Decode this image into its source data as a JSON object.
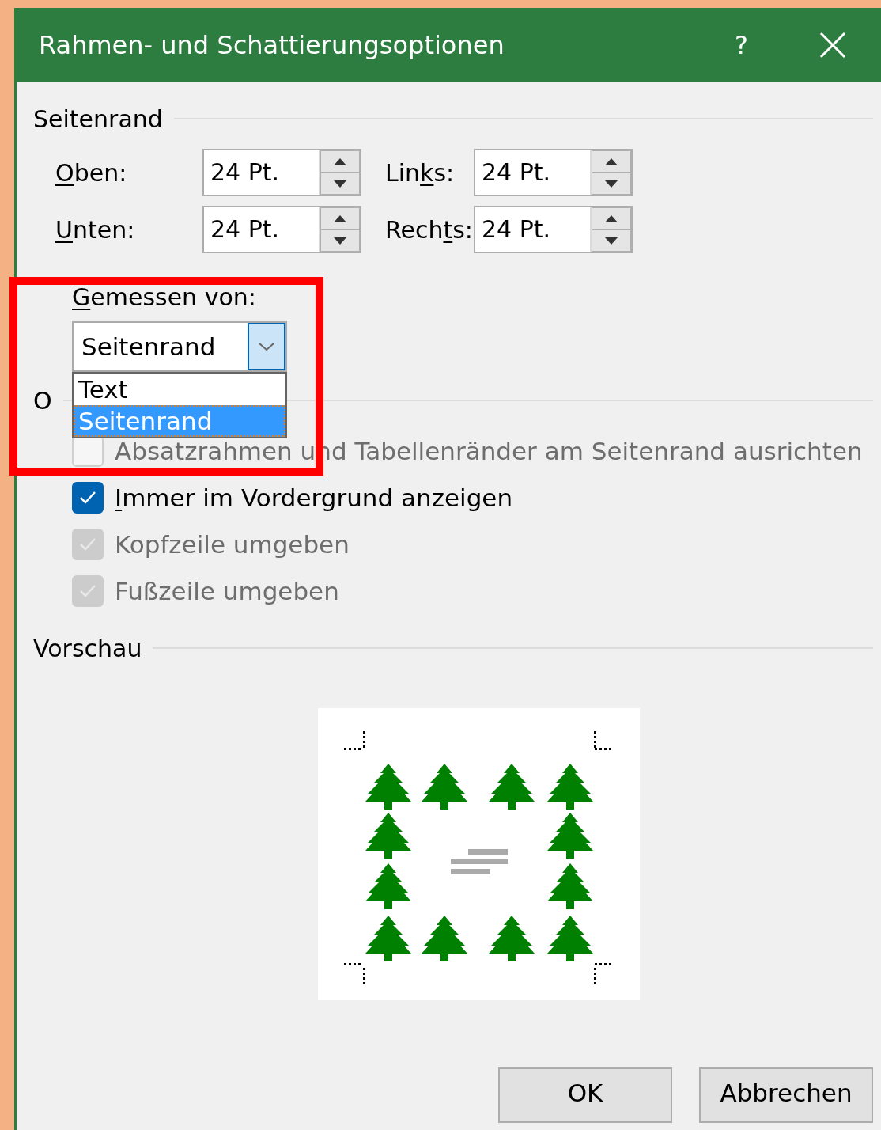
{
  "window": {
    "title": "Rahmen- und Schattierungsoptionen",
    "help": "?"
  },
  "margin_section": {
    "title": "Seitenrand",
    "fields": [
      {
        "label": [
          {
            "t": "O",
            "underlined": true
          },
          {
            "t": "ben:",
            "underlined": false
          }
        ],
        "value": "24 Pt."
      },
      {
        "label": [
          {
            "t": "Lin",
            "underlined": false
          },
          {
            "t": "k",
            "underlined": true
          },
          {
            "t": "s:",
            "underlined": false
          }
        ],
        "value": "24 Pt."
      },
      {
        "label": [
          {
            "t": "U",
            "underlined": true
          },
          {
            "t": "nten:",
            "underlined": false
          }
        ],
        "value": "24 Pt."
      },
      {
        "label": [
          {
            "t": "Rech",
            "underlined": false
          },
          {
            "t": "t",
            "underlined": true
          },
          {
            "t": "s:",
            "underlined": false
          }
        ],
        "value": "24 Pt."
      }
    ],
    "measured_from": {
      "label": [
        {
          "t": "G",
          "underlined": true
        },
        {
          "t": "emessen von:",
          "underlined": false
        }
      ],
      "value": "Seitenrand",
      "expanded": true,
      "options": [
        {
          "label": "Text",
          "selected": false
        },
        {
          "label": "Seitenrand",
          "selected": true
        }
      ]
    }
  },
  "options_section": {
    "title": "O",
    "items": [
      {
        "label": [
          {
            "t": "Absatzrahmen und Tabellenränder am Seitenrand ausrichten",
            "underlined": false
          }
        ],
        "checked": false,
        "disabled": true
      },
      {
        "label": [
          {
            "t": "I",
            "underlined": true
          },
          {
            "t": "mmer im Vordergrund anzeigen",
            "underlined": false
          }
        ],
        "checked": true,
        "disabled": false
      },
      {
        "label": [
          {
            "t": "Kopfzeile umgeben",
            "underlined": false
          }
        ],
        "checked": true,
        "disabled": true
      },
      {
        "label": [
          {
            "t": "Fußzeile umgeben",
            "underlined": false
          }
        ],
        "checked": true,
        "disabled": true
      }
    ]
  },
  "preview_section": {
    "title": "Vorschau"
  },
  "buttons": [
    "OK",
    "Abbrechen"
  ]
}
